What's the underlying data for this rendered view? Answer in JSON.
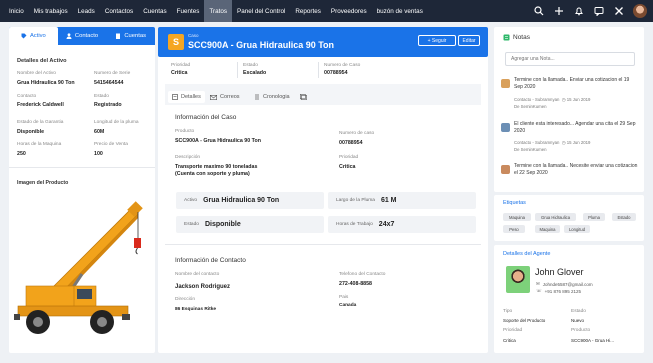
{
  "nav": {
    "items": [
      "Inicio",
      "Mis trabajos",
      "Leads",
      "Contactos",
      "Cuentas",
      "Fuentes",
      "Tratos",
      "Panel del Control",
      "Reportes",
      "Proveedores",
      "buzón de ventas"
    ],
    "active_index": 6
  },
  "left": {
    "tabs": [
      {
        "label": "Activo",
        "icon": "tag-icon"
      },
      {
        "label": "Contacto",
        "icon": "person-icon"
      },
      {
        "label": "Cuentas",
        "icon": "building-icon"
      }
    ],
    "section_title": "Detalles del Activo",
    "fields": {
      "asset_name_label": "Nombre del Activo",
      "asset_name": "Grua Hidraulica 90 Ton",
      "serial_label": "Numero de Serie",
      "serial": "5415464544",
      "contact_label": "Contacto",
      "contact": "Frederick Caldwell",
      "status_label": "Estado",
      "status": "Registrado",
      "warranty_label": "Estado de la Garantia",
      "warranty": "Disponible",
      "boom_label": "Longitud de la pluma",
      "boom": "60M",
      "hours_label": "Horas de la Maquina",
      "hours": "250",
      "price_label": "Precio de Venta",
      "price": "100"
    },
    "image_label": "Imagen del Producto"
  },
  "case": {
    "type_label": "Caso",
    "title": "SCC900A -  Grua Hidraulica  90 Ton",
    "follow_label": "+ Seguir",
    "edit_label": "Editar",
    "priority_label": "Prioridad",
    "priority": "Critica",
    "state_label": "Estado",
    "state": "Escalado",
    "case_no_label": "Numero de Caso",
    "case_no": "00788954",
    "tabs": [
      "Detalles",
      "Correos",
      "Cronologia"
    ],
    "info_title": "Información del Caso",
    "product_label": "Producto",
    "product": "SCC900A - Grua Hidraulica 90 Ton",
    "case_number_label": "Numero de caso",
    "case_number": "00788954",
    "desc_label": "Descripción",
    "desc": "Transporte maximo 90 toneladas (Cuenta con soporte y pluma)",
    "priority2_label": "Prioridad",
    "priority2": "Critica",
    "kv": [
      {
        "k": "Activo",
        "v": "Grua Hidraulica 90 Ton"
      },
      {
        "k": "Largo de la Pluma",
        "v": "61 M"
      },
      {
        "k": "Estado",
        "v": "Disponible"
      },
      {
        "k": "Horas de Trabajo",
        "v": "24x7"
      }
    ],
    "contact_title": "Información de Contacto",
    "cname_label": "Nombre del contacto",
    "cname": "Jackson Rodriguez",
    "phone_label": "Telefono del Contacto",
    "phone": "272-408-8858",
    "addr_label": "Dirección",
    "addr": "86 Esquinas Ritke",
    "country_label": "Pais",
    "country": "Canada"
  },
  "notes": {
    "title": "Notas",
    "placeholder": "Agregar una Nota...",
    "items": [
      {
        "text": "Termine con la llamada.. Enviar una cotizacion el 19 Sep 2020",
        "meta1": "Contacto - Subramnyan",
        "date": "15 Jun 2019",
        "meta2": "De  SeminKumen",
        "color": "#d9a05b"
      },
      {
        "text": "El cliente esta interesado... Agendar una cita el 29 Sep 2020",
        "meta1": "Contacto - Subramnyan",
        "date": "15 Jun 2019",
        "meta2": "De  SeminKumen",
        "color": "#6c8fb5"
      },
      {
        "text": "Termine con la llamada.. Necesite enviar una cotizacion el 22 Sep 2020",
        "meta1": "",
        "date": "",
        "meta2": "",
        "color": "#c98a5e"
      }
    ]
  },
  "tags": {
    "title": "Etiquetas",
    "items": [
      "Maquina",
      "Grua Hidraulica",
      "Pluma",
      "Estado",
      "Peso",
      "Maquina",
      "Longitud"
    ]
  },
  "agent": {
    "title": "Detalles del Agente",
    "name": "John Glover",
    "email": "Johnde5587@gmail.com",
    "phone": "+91 876 895 2125",
    "type_label": "Tipo",
    "type": "Soporte del Producto",
    "state_label": "Estado",
    "state": "Nuevo",
    "priority_label": "Prioridad",
    "priority": "Critica",
    "product_label": "Producto",
    "product": "SCC900A - Grua Hi..."
  }
}
